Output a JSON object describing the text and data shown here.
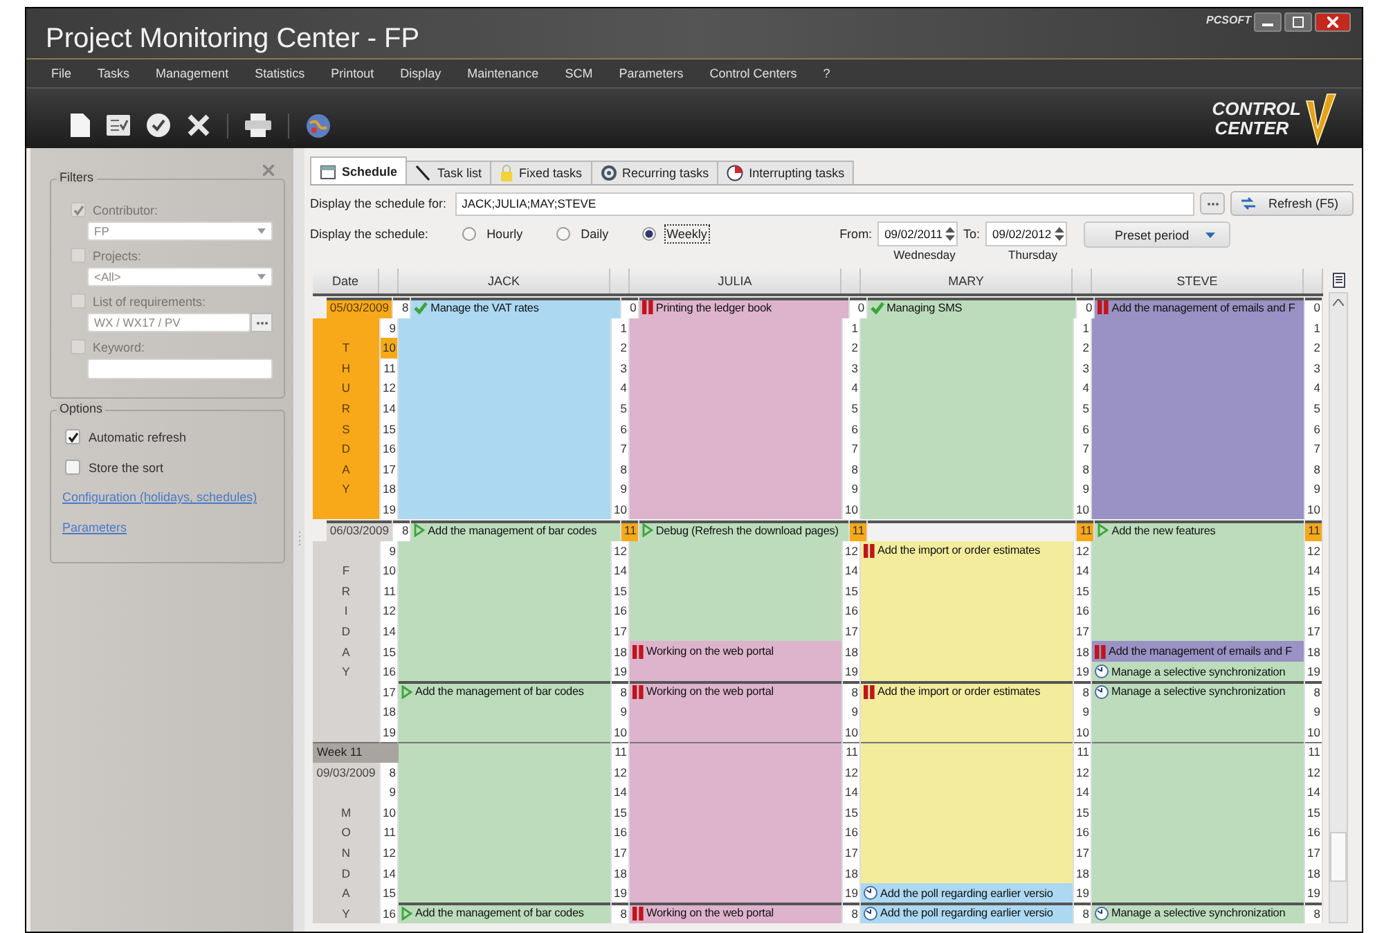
{
  "window": {
    "title": "Project Monitoring Center - FP",
    "vendor_logo": "PCSOFT"
  },
  "menu": [
    "File",
    "Tasks",
    "Management",
    "Statistics",
    "Printout",
    "Display",
    "Maintenance",
    "SCM",
    "Parameters",
    "Control Centers",
    "?"
  ],
  "brand": {
    "line_1": "CONTROL",
    "line_2": "CENTER"
  },
  "filters_panel": {
    "filters_title": "Filters",
    "filters": [
      {
        "kind": "select",
        "label": "Contributor:",
        "checked": true,
        "disabled": true,
        "value": "FP"
      },
      {
        "kind": "select",
        "label": "Projects:",
        "checked": false,
        "disabled": true,
        "value": "<All>"
      },
      {
        "kind": "picker",
        "label": "List of requirements:",
        "checked": false,
        "disabled": true,
        "value": "WX / WX17 / PV"
      },
      {
        "kind": "text",
        "label": "Keyword:",
        "checked": false,
        "disabled": true
      }
    ],
    "options_title": "Options",
    "options": [
      {
        "label": "Automatic refresh",
        "checked": true
      },
      {
        "label": "Store the sort",
        "checked": false
      }
    ],
    "links": [
      "Configuration (holidays, schedules)",
      "Parameters"
    ]
  },
  "tabs": [
    {
      "label": "Schedule",
      "selected": true,
      "kind": "calendar"
    },
    {
      "label": "Task list",
      "selected": false,
      "kind": "pen"
    },
    {
      "label": "Fixed tasks",
      "selected": false,
      "kind": "lock"
    },
    {
      "label": "Recurring tasks",
      "selected": false,
      "kind": "cycle"
    },
    {
      "label": "Interrupting tasks",
      "selected": false,
      "kind": "pie"
    }
  ],
  "schedule_for": {
    "label": "Display the schedule for:",
    "value": "JACK;JULIA;MAY;STEVE",
    "refresh": "Refresh (F5)"
  },
  "display_mode": {
    "label": "Display the schedule:",
    "options": [
      {
        "label": "Hourly",
        "selected": false
      },
      {
        "label": "Daily",
        "selected": false
      },
      {
        "label": "Weekly",
        "selected": true
      }
    ]
  },
  "period": {
    "from_label": "From:",
    "from": "09/02/2011",
    "from_day": "Wednesday",
    "to_label": "To:",
    "to": "09/02/2012",
    "to_day": "Thursday",
    "preset": "Preset period"
  },
  "schedule": {
    "columns": [
      "Date",
      "",
      "JACK",
      "",
      "JULIA",
      "",
      "MARY",
      "",
      "STEVE",
      ""
    ],
    "rows": [
      {
        "kind": "day_start",
        "cells": [
          {
            "kind": "date",
            "today": true,
            "text": "05/03/2009"
          },
          {
            "kind": "hour",
            "text": "8",
            "highlighted": false
          },
          {
            "kind": "check",
            "color": "#acd8f2",
            "text": "Manage the VAT rates"
          },
          {
            "kind": "hour",
            "text": "0",
            "highlighted": false
          },
          {
            "kind": "pause",
            "color": "#deb3cc",
            "text": "Printing the ledger book"
          },
          {
            "kind": "hour",
            "text": "0",
            "highlighted": false
          },
          {
            "kind": "check",
            "color": "#bcdcbc",
            "text": "Managing SMS"
          },
          {
            "kind": "hour",
            "text": "0",
            "highlighted": false
          },
          {
            "kind": "pause",
            "color": "#9a91c4",
            "text": "Add the management of emails and F"
          },
          {
            "kind": "hour",
            "text": "0",
            "highlighted": false
          }
        ]
      },
      {
        "kind": "hour",
        "cells": [
          {
            "kind": "date",
            "today": true
          },
          {
            "kind": "hour",
            "text": "9",
            "highlighted": false
          },
          {
            "kind": "blank",
            "color": "#acd8f2"
          },
          {
            "kind": "hour",
            "text": "1",
            "highlighted": false
          },
          {
            "kind": "blank",
            "color": "#deb3cc"
          },
          {
            "kind": "hour",
            "text": "1",
            "highlighted": false
          },
          {
            "kind": "blank",
            "color": "#bcdcbc"
          },
          {
            "kind": "hour",
            "text": "1",
            "highlighted": false
          },
          {
            "kind": "blank",
            "color": "#9a91c4"
          },
          {
            "kind": "hour",
            "text": "1",
            "highlighted": false
          }
        ]
      },
      {
        "kind": "hour",
        "cells": [
          {
            "kind": "date",
            "today": true,
            "text": "T"
          },
          {
            "kind": "hour",
            "text": "10",
            "highlighted": true
          },
          {
            "kind": "blank",
            "color": "#acd8f2"
          },
          {
            "kind": "hour",
            "text": "2",
            "highlighted": false
          },
          {
            "kind": "blank",
            "color": "#deb3cc"
          },
          {
            "kind": "hour",
            "text": "2",
            "highlighted": false
          },
          {
            "kind": "blank",
            "color": "#bcdcbc"
          },
          {
            "kind": "hour",
            "text": "2",
            "highlighted": false
          },
          {
            "kind": "blank",
            "color": "#9a91c4"
          },
          {
            "kind": "hour",
            "text": "2",
            "highlighted": false
          }
        ]
      },
      {
        "kind": "hour",
        "cells": [
          {
            "kind": "date",
            "today": true,
            "text": "H"
          },
          {
            "kind": "hour",
            "text": "11",
            "highlighted": false
          },
          {
            "kind": "blank",
            "color": "#acd8f2"
          },
          {
            "kind": "hour",
            "text": "3",
            "highlighted": false
          },
          {
            "kind": "blank",
            "color": "#deb3cc"
          },
          {
            "kind": "hour",
            "text": "3",
            "highlighted": false
          },
          {
            "kind": "blank",
            "color": "#bcdcbc"
          },
          {
            "kind": "hour",
            "text": "3",
            "highlighted": false
          },
          {
            "kind": "blank",
            "color": "#9a91c4"
          },
          {
            "kind": "hour",
            "text": "3",
            "highlighted": false
          }
        ]
      },
      {
        "kind": "hour",
        "cells": [
          {
            "kind": "date",
            "today": true,
            "text": "U"
          },
          {
            "kind": "hour",
            "text": "12",
            "highlighted": false
          },
          {
            "kind": "blank",
            "color": "#acd8f2"
          },
          {
            "kind": "hour",
            "text": "4",
            "highlighted": false
          },
          {
            "kind": "blank",
            "color": "#deb3cc"
          },
          {
            "kind": "hour",
            "text": "4",
            "highlighted": false
          },
          {
            "kind": "blank",
            "color": "#bcdcbc"
          },
          {
            "kind": "hour",
            "text": "4",
            "highlighted": false
          },
          {
            "kind": "blank",
            "color": "#9a91c4"
          },
          {
            "kind": "hour",
            "text": "4",
            "highlighted": false
          }
        ]
      },
      {
        "kind": "hour",
        "cells": [
          {
            "kind": "date",
            "today": true,
            "text": "R"
          },
          {
            "kind": "hour",
            "text": "14",
            "highlighted": false
          },
          {
            "kind": "blank",
            "color": "#acd8f2"
          },
          {
            "kind": "hour",
            "text": "5",
            "highlighted": false
          },
          {
            "kind": "blank",
            "color": "#deb3cc"
          },
          {
            "kind": "hour",
            "text": "5",
            "highlighted": false
          },
          {
            "kind": "blank",
            "color": "#bcdcbc"
          },
          {
            "kind": "hour",
            "text": "5",
            "highlighted": false
          },
          {
            "kind": "blank",
            "color": "#9a91c4"
          },
          {
            "kind": "hour",
            "text": "5",
            "highlighted": false
          }
        ]
      },
      {
        "kind": "hour",
        "cells": [
          {
            "kind": "date",
            "today": true,
            "text": "S"
          },
          {
            "kind": "hour",
            "text": "15",
            "highlighted": false
          },
          {
            "kind": "blank",
            "color": "#acd8f2"
          },
          {
            "kind": "hour",
            "text": "6",
            "highlighted": false
          },
          {
            "kind": "blank",
            "color": "#deb3cc"
          },
          {
            "kind": "hour",
            "text": "6",
            "highlighted": false
          },
          {
            "kind": "blank",
            "color": "#bcdcbc"
          },
          {
            "kind": "hour",
            "text": "6",
            "highlighted": false
          },
          {
            "kind": "blank",
            "color": "#9a91c4"
          },
          {
            "kind": "hour",
            "text": "6",
            "highlighted": false
          }
        ]
      },
      {
        "kind": "hour",
        "cells": [
          {
            "kind": "date",
            "today": true,
            "text": "D"
          },
          {
            "kind": "hour",
            "text": "16",
            "highlighted": false
          },
          {
            "kind": "blank",
            "color": "#acd8f2"
          },
          {
            "kind": "hour",
            "text": "7",
            "highlighted": false
          },
          {
            "kind": "blank",
            "color": "#deb3cc"
          },
          {
            "kind": "hour",
            "text": "7",
            "highlighted": false
          },
          {
            "kind": "blank",
            "color": "#bcdcbc"
          },
          {
            "kind": "hour",
            "text": "7",
            "highlighted": false
          },
          {
            "kind": "blank",
            "color": "#9a91c4"
          },
          {
            "kind": "hour",
            "text": "7",
            "highlighted": false
          }
        ]
      },
      {
        "kind": "hour",
        "cells": [
          {
            "kind": "date",
            "today": true,
            "text": "A"
          },
          {
            "kind": "hour",
            "text": "17",
            "highlighted": false
          },
          {
            "kind": "blank",
            "color": "#acd8f2"
          },
          {
            "kind": "hour",
            "text": "8",
            "highlighted": false
          },
          {
            "kind": "blank",
            "color": "#deb3cc"
          },
          {
            "kind": "hour",
            "text": "8",
            "highlighted": false
          },
          {
            "kind": "blank",
            "color": "#bcdcbc"
          },
          {
            "kind": "hour",
            "text": "8",
            "highlighted": false
          },
          {
            "kind": "blank",
            "color": "#9a91c4"
          },
          {
            "kind": "hour",
            "text": "8",
            "highlighted": false
          }
        ]
      },
      {
        "kind": "hour",
        "cells": [
          {
            "kind": "date",
            "today": true,
            "text": "Y"
          },
          {
            "kind": "hour",
            "text": "18",
            "highlighted": false
          },
          {
            "kind": "blank",
            "color": "#acd8f2"
          },
          {
            "kind": "hour",
            "text": "9",
            "highlighted": false
          },
          {
            "kind": "blank",
            "color": "#deb3cc"
          },
          {
            "kind": "hour",
            "text": "9",
            "highlighted": false
          },
          {
            "kind": "blank",
            "color": "#bcdcbc"
          },
          {
            "kind": "hour",
            "text": "9",
            "highlighted": false
          },
          {
            "kind": "blank",
            "color": "#9a91c4"
          },
          {
            "kind": "hour",
            "text": "9",
            "highlighted": false
          }
        ]
      },
      {
        "kind": "hour",
        "cells": [
          {
            "kind": "date",
            "today": true
          },
          {
            "kind": "hour",
            "text": "19",
            "highlighted": false
          },
          {
            "kind": "blank",
            "color": "#acd8f2"
          },
          {
            "kind": "hour",
            "text": "10",
            "highlighted": false
          },
          {
            "kind": "blank",
            "color": "#deb3cc"
          },
          {
            "kind": "hour",
            "text": "10",
            "highlighted": false
          },
          {
            "kind": "blank",
            "color": "#bcdcbc"
          },
          {
            "kind": "hour",
            "text": "10",
            "highlighted": false
          },
          {
            "kind": "blank",
            "color": "#9a91c4"
          },
          {
            "kind": "hour",
            "text": "10",
            "highlighted": false
          }
        ]
      },
      {
        "kind": "day_start",
        "cells": [
          {
            "kind": "date",
            "today": false,
            "text": "06/03/2009"
          },
          {
            "kind": "hour",
            "text": "8",
            "highlighted": false
          },
          {
            "kind": "play",
            "color": "#bcdcbc",
            "text": "Add the management of bar codes"
          },
          {
            "kind": "hour",
            "text": "11",
            "highlighted": true
          },
          {
            "kind": "play",
            "color": "#bcdcbc",
            "text": "Debug (Refresh the download pages)"
          },
          {
            "kind": "hour",
            "text": "11",
            "highlighted": true
          },
          {
            "kind": "blank",
            "color": "#f2f2f2"
          },
          {
            "kind": "hour",
            "text": "11",
            "highlighted": true
          },
          {
            "kind": "play",
            "color": "#bcdcbc",
            "text": "Add the new features"
          },
          {
            "kind": "hour",
            "text": "11",
            "highlighted": true
          }
        ]
      },
      {
        "kind": "hour",
        "cells": [
          {
            "kind": "date",
            "today": false
          },
          {
            "kind": "hour",
            "text": "9",
            "highlighted": false
          },
          {
            "kind": "blank",
            "color": "#bcdcbc"
          },
          {
            "kind": "hour",
            "text": "12",
            "highlighted": false
          },
          {
            "kind": "blank",
            "color": "#bcdcbc"
          },
          {
            "kind": "hour",
            "text": "12",
            "highlighted": false
          },
          {
            "kind": "pause",
            "color": "#f2ec9c",
            "text": "Add the import or order estimates"
          },
          {
            "kind": "hour",
            "text": "12",
            "highlighted": false
          },
          {
            "kind": "blank",
            "color": "#bcdcbc"
          },
          {
            "kind": "hour",
            "text": "12",
            "highlighted": false
          }
        ]
      },
      {
        "kind": "hour",
        "cells": [
          {
            "kind": "date",
            "today": false,
            "text": "F"
          },
          {
            "kind": "hour",
            "text": "10",
            "highlighted": false
          },
          {
            "kind": "blank",
            "color": "#bcdcbc"
          },
          {
            "kind": "hour",
            "text": "14",
            "highlighted": false
          },
          {
            "kind": "blank",
            "color": "#bcdcbc"
          },
          {
            "kind": "hour",
            "text": "14",
            "highlighted": false
          },
          {
            "kind": "blank",
            "color": "#f2ec9c"
          },
          {
            "kind": "hour",
            "text": "14",
            "highlighted": false
          },
          {
            "kind": "blank",
            "color": "#bcdcbc"
          },
          {
            "kind": "hour",
            "text": "14",
            "highlighted": false
          }
        ]
      },
      {
        "kind": "hour",
        "cells": [
          {
            "kind": "date",
            "today": false,
            "text": "R"
          },
          {
            "kind": "hour",
            "text": "11",
            "highlighted": false
          },
          {
            "kind": "blank",
            "color": "#bcdcbc"
          },
          {
            "kind": "hour",
            "text": "15",
            "highlighted": false
          },
          {
            "kind": "blank",
            "color": "#bcdcbc"
          },
          {
            "kind": "hour",
            "text": "15",
            "highlighted": false
          },
          {
            "kind": "blank",
            "color": "#f2ec9c"
          },
          {
            "kind": "hour",
            "text": "15",
            "highlighted": false
          },
          {
            "kind": "blank",
            "color": "#bcdcbc"
          },
          {
            "kind": "hour",
            "text": "15",
            "highlighted": false
          }
        ]
      },
      {
        "kind": "hour",
        "cells": [
          {
            "kind": "date",
            "today": false,
            "text": "I"
          },
          {
            "kind": "hour",
            "text": "12",
            "highlighted": false
          },
          {
            "kind": "blank",
            "color": "#bcdcbc"
          },
          {
            "kind": "hour",
            "text": "16",
            "highlighted": false
          },
          {
            "kind": "blank",
            "color": "#bcdcbc"
          },
          {
            "kind": "hour",
            "text": "16",
            "highlighted": false
          },
          {
            "kind": "blank",
            "color": "#f2ec9c"
          },
          {
            "kind": "hour",
            "text": "16",
            "highlighted": false
          },
          {
            "kind": "blank",
            "color": "#bcdcbc"
          },
          {
            "kind": "hour",
            "text": "16",
            "highlighted": false
          }
        ]
      },
      {
        "kind": "hour",
        "cells": [
          {
            "kind": "date",
            "today": false,
            "text": "D"
          },
          {
            "kind": "hour",
            "text": "14",
            "highlighted": false
          },
          {
            "kind": "blank",
            "color": "#bcdcbc"
          },
          {
            "kind": "hour",
            "text": "17",
            "highlighted": false
          },
          {
            "kind": "blank",
            "color": "#bcdcbc"
          },
          {
            "kind": "hour",
            "text": "17",
            "highlighted": false
          },
          {
            "kind": "blank",
            "color": "#f2ec9c"
          },
          {
            "kind": "hour",
            "text": "17",
            "highlighted": false
          },
          {
            "kind": "blank",
            "color": "#bcdcbc"
          },
          {
            "kind": "hour",
            "text": "17",
            "highlighted": false
          }
        ]
      },
      {
        "kind": "hour",
        "cells": [
          {
            "kind": "date",
            "today": false,
            "text": "A"
          },
          {
            "kind": "hour",
            "text": "15",
            "highlighted": false
          },
          {
            "kind": "blank",
            "color": "#bcdcbc"
          },
          {
            "kind": "hour",
            "text": "18",
            "highlighted": false
          },
          {
            "kind": "pause",
            "color": "#deb3cc",
            "text": "Working on the web portal"
          },
          {
            "kind": "hour",
            "text": "18",
            "highlighted": false
          },
          {
            "kind": "blank",
            "color": "#f2ec9c"
          },
          {
            "kind": "hour",
            "text": "18",
            "highlighted": false
          },
          {
            "kind": "pause",
            "color": "#9a91c4",
            "text": "Add the management of emails and F"
          },
          {
            "kind": "hour",
            "text": "18",
            "highlighted": false
          }
        ]
      },
      {
        "kind": "hour",
        "cells": [
          {
            "kind": "date",
            "today": false,
            "text": "Y"
          },
          {
            "kind": "hour",
            "text": "16",
            "highlighted": false
          },
          {
            "kind": "blank",
            "color": "#bcdcbc"
          },
          {
            "kind": "hour",
            "text": "19",
            "highlighted": false
          },
          {
            "kind": "blank",
            "color": "#deb3cc"
          },
          {
            "kind": "hour",
            "text": "19",
            "highlighted": false
          },
          {
            "kind": "blank",
            "color": "#f2ec9c"
          },
          {
            "kind": "hour",
            "text": "19",
            "highlighted": false
          },
          {
            "kind": "clock",
            "color": "#bcdcbc",
            "text": "Manage a selective synchronization"
          },
          {
            "kind": "hour",
            "text": "19",
            "highlighted": false
          }
        ]
      },
      {
        "kind": "shift_start",
        "cells": [
          {
            "kind": "date",
            "today": false
          },
          {
            "kind": "hour",
            "text": "17",
            "highlighted": false
          },
          {
            "kind": "play",
            "color": "#bcdcbc",
            "text": "Add the management of bar codes"
          },
          {
            "kind": "hour",
            "text": "8",
            "highlighted": false
          },
          {
            "kind": "pause",
            "color": "#deb3cc",
            "text": "Working on the web portal"
          },
          {
            "kind": "hour",
            "text": "8",
            "highlighted": false
          },
          {
            "kind": "pause",
            "color": "#f2ec9c",
            "text": "Add the import or order estimates"
          },
          {
            "kind": "hour",
            "text": "8",
            "highlighted": false
          },
          {
            "kind": "clock",
            "color": "#bcdcbc",
            "text": "Manage a selective synchronization"
          },
          {
            "kind": "hour",
            "text": "8",
            "highlighted": false
          }
        ]
      },
      {
        "kind": "hour",
        "cells": [
          {
            "kind": "date",
            "today": false
          },
          {
            "kind": "hour",
            "text": "18",
            "highlighted": false
          },
          {
            "kind": "blank",
            "color": "#bcdcbc"
          },
          {
            "kind": "hour",
            "text": "9",
            "highlighted": false
          },
          {
            "kind": "blank",
            "color": "#deb3cc"
          },
          {
            "kind": "hour",
            "text": "9",
            "highlighted": false
          },
          {
            "kind": "blank",
            "color": "#f2ec9c"
          },
          {
            "kind": "hour",
            "text": "9",
            "highlighted": false
          },
          {
            "kind": "blank",
            "color": "#bcdcbc"
          },
          {
            "kind": "hour",
            "text": "9",
            "highlighted": false
          }
        ]
      },
      {
        "kind": "hour",
        "cells": [
          {
            "kind": "date",
            "today": false
          },
          {
            "kind": "hour",
            "text": "19",
            "highlighted": false
          },
          {
            "kind": "blank",
            "color": "#bcdcbc"
          },
          {
            "kind": "hour",
            "text": "10",
            "highlighted": false
          },
          {
            "kind": "blank",
            "color": "#deb3cc"
          },
          {
            "kind": "hour",
            "text": "10",
            "highlighted": false
          },
          {
            "kind": "blank",
            "color": "#f2ec9c"
          },
          {
            "kind": "hour",
            "text": "10",
            "highlighted": false
          },
          {
            "kind": "blank",
            "color": "#bcdcbc"
          },
          {
            "kind": "hour",
            "text": "10",
            "highlighted": false
          }
        ]
      },
      {
        "kind": "week",
        "cells": [
          {
            "kind": "week",
            "today": false,
            "text": "Week 11"
          },
          {
            "kind": "hour",
            "highlighted": false
          },
          {
            "kind": "blank",
            "color": "#bcdcbc"
          },
          {
            "kind": "hour",
            "text": "11",
            "highlighted": false
          },
          {
            "kind": "blank",
            "color": "#deb3cc"
          },
          {
            "kind": "hour",
            "text": "11",
            "highlighted": false
          },
          {
            "kind": "blank",
            "color": "#f2ec9c"
          },
          {
            "kind": "hour",
            "text": "11",
            "highlighted": false
          },
          {
            "kind": "blank",
            "color": "#bcdcbc"
          },
          {
            "kind": "hour",
            "text": "11",
            "highlighted": false
          }
        ]
      },
      {
        "kind": "hour",
        "cells": [
          {
            "kind": "date",
            "today": false,
            "text": "09/03/2009"
          },
          {
            "kind": "hour",
            "text": "8",
            "highlighted": false
          },
          {
            "kind": "blank",
            "color": "#bcdcbc"
          },
          {
            "kind": "hour",
            "text": "12",
            "highlighted": false
          },
          {
            "kind": "blank",
            "color": "#deb3cc"
          },
          {
            "kind": "hour",
            "text": "12",
            "highlighted": false
          },
          {
            "kind": "blank",
            "color": "#f2ec9c"
          },
          {
            "kind": "hour",
            "text": "12",
            "highlighted": false
          },
          {
            "kind": "blank",
            "color": "#bcdcbc"
          },
          {
            "kind": "hour",
            "text": "12",
            "highlighted": false
          }
        ]
      },
      {
        "kind": "hour",
        "cells": [
          {
            "kind": "date",
            "today": false
          },
          {
            "kind": "hour",
            "text": "9",
            "highlighted": false
          },
          {
            "kind": "blank",
            "color": "#bcdcbc"
          },
          {
            "kind": "hour",
            "text": "14",
            "highlighted": false
          },
          {
            "kind": "blank",
            "color": "#deb3cc"
          },
          {
            "kind": "hour",
            "text": "14",
            "highlighted": false
          },
          {
            "kind": "blank",
            "color": "#f2ec9c"
          },
          {
            "kind": "hour",
            "text": "14",
            "highlighted": false
          },
          {
            "kind": "blank",
            "color": "#bcdcbc"
          },
          {
            "kind": "hour",
            "text": "14",
            "highlighted": false
          }
        ]
      },
      {
        "kind": "hour",
        "cells": [
          {
            "kind": "date",
            "today": false,
            "text": "M"
          },
          {
            "kind": "hour",
            "text": "10",
            "highlighted": false
          },
          {
            "kind": "blank",
            "color": "#bcdcbc"
          },
          {
            "kind": "hour",
            "text": "15",
            "highlighted": false
          },
          {
            "kind": "blank",
            "color": "#deb3cc"
          },
          {
            "kind": "hour",
            "text": "15",
            "highlighted": false
          },
          {
            "kind": "blank",
            "color": "#f2ec9c"
          },
          {
            "kind": "hour",
            "text": "15",
            "highlighted": false
          },
          {
            "kind": "blank",
            "color": "#bcdcbc"
          },
          {
            "kind": "hour",
            "text": "15",
            "highlighted": false
          }
        ]
      },
      {
        "kind": "hour",
        "cells": [
          {
            "kind": "date",
            "today": false,
            "text": "O"
          },
          {
            "kind": "hour",
            "text": "11",
            "highlighted": false
          },
          {
            "kind": "blank",
            "color": "#bcdcbc"
          },
          {
            "kind": "hour",
            "text": "16",
            "highlighted": false
          },
          {
            "kind": "blank",
            "color": "#deb3cc"
          },
          {
            "kind": "hour",
            "text": "16",
            "highlighted": false
          },
          {
            "kind": "blank",
            "color": "#f2ec9c"
          },
          {
            "kind": "hour",
            "text": "16",
            "highlighted": false
          },
          {
            "kind": "blank",
            "color": "#bcdcbc"
          },
          {
            "kind": "hour",
            "text": "16",
            "highlighted": false
          }
        ]
      },
      {
        "kind": "hour",
        "cells": [
          {
            "kind": "date",
            "today": false,
            "text": "N"
          },
          {
            "kind": "hour",
            "text": "12",
            "highlighted": false
          },
          {
            "kind": "blank",
            "color": "#bcdcbc"
          },
          {
            "kind": "hour",
            "text": "17",
            "highlighted": false
          },
          {
            "kind": "blank",
            "color": "#deb3cc"
          },
          {
            "kind": "hour",
            "text": "17",
            "highlighted": false
          },
          {
            "kind": "blank",
            "color": "#f2ec9c"
          },
          {
            "kind": "hour",
            "text": "17",
            "highlighted": false
          },
          {
            "kind": "blank",
            "color": "#bcdcbc"
          },
          {
            "kind": "hour",
            "text": "17",
            "highlighted": false
          }
        ]
      },
      {
        "kind": "hour",
        "cells": [
          {
            "kind": "date",
            "today": false,
            "text": "D"
          },
          {
            "kind": "hour",
            "text": "14",
            "highlighted": false
          },
          {
            "kind": "blank",
            "color": "#bcdcbc"
          },
          {
            "kind": "hour",
            "text": "18",
            "highlighted": false
          },
          {
            "kind": "blank",
            "color": "#deb3cc"
          },
          {
            "kind": "hour",
            "text": "18",
            "highlighted": false
          },
          {
            "kind": "blank",
            "color": "#f2ec9c"
          },
          {
            "kind": "hour",
            "text": "18",
            "highlighted": false
          },
          {
            "kind": "blank",
            "color": "#bcdcbc"
          },
          {
            "kind": "hour",
            "text": "18",
            "highlighted": false
          }
        ]
      },
      {
        "kind": "hour",
        "cells": [
          {
            "kind": "date",
            "today": false,
            "text": "A"
          },
          {
            "kind": "hour",
            "text": "15",
            "highlighted": false
          },
          {
            "kind": "blank",
            "color": "#bcdcbc"
          },
          {
            "kind": "hour",
            "text": "19",
            "highlighted": false
          },
          {
            "kind": "blank",
            "color": "#deb3cc"
          },
          {
            "kind": "hour",
            "text": "19",
            "highlighted": false
          },
          {
            "kind": "clock",
            "color": "#acd8f2",
            "text": "Add the poll regarding earlier versio"
          },
          {
            "kind": "hour",
            "text": "19",
            "highlighted": false
          },
          {
            "kind": "blank",
            "color": "#bcdcbc"
          },
          {
            "kind": "hour",
            "text": "19",
            "highlighted": false
          }
        ]
      },
      {
        "kind": "shift_start",
        "cells": [
          {
            "kind": "date",
            "today": false,
            "text": "Y"
          },
          {
            "kind": "hour",
            "text": "16",
            "highlighted": false
          },
          {
            "kind": "play",
            "color": "#bcdcbc",
            "text": "Add the management of bar codes"
          },
          {
            "kind": "hour",
            "text": "8",
            "highlighted": false
          },
          {
            "kind": "pause",
            "color": "#deb3cc",
            "text": "Working on the web portal"
          },
          {
            "kind": "hour",
            "text": "8",
            "highlighted": false
          },
          {
            "kind": "clock",
            "color": "#acd8f2",
            "text": "Add the poll regarding earlier versio"
          },
          {
            "kind": "hour",
            "text": "8",
            "highlighted": false
          },
          {
            "kind": "clock",
            "color": "#bcdcbc",
            "text": "Manage a selective synchronization"
          },
          {
            "kind": "hour",
            "text": "8",
            "highlighted": false
          }
        ]
      }
    ]
  }
}
